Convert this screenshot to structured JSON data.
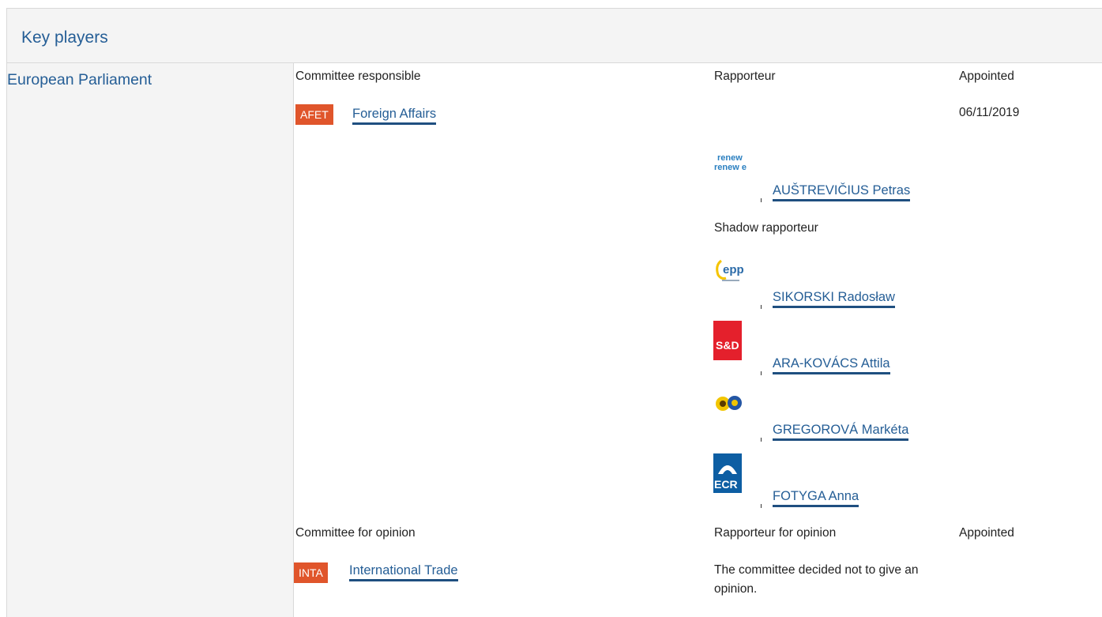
{
  "section": {
    "title": "Key players"
  },
  "institution": "European Parliament",
  "responsible": {
    "committee_header": "Committee responsible",
    "rapporteur_header": "Rapporteur",
    "appointed_header": "Appointed",
    "committee_code": "AFET",
    "committee_name": "Foreign Affairs",
    "appointed_date": "06/11/2019",
    "rapporteur": {
      "name": "AUŠTREVIČIUS Petras",
      "group_logo": "renew europe.",
      "group_icon": "renew-europe-logo-icon"
    },
    "shadow_header": "Shadow rapporteur",
    "shadows": [
      {
        "name": "SIKORSKI Radosław",
        "group_icon": "epp-logo-icon",
        "logo_text": "epp"
      },
      {
        "name": "ARA-KOVÁCS Attila",
        "group_icon": "s-and-d-logo-icon",
        "logo_text": "S&D"
      },
      {
        "name": "GREGOROVÁ Markéta",
        "group_icon": "greens-efa-logo-icon",
        "logo_text": ""
      },
      {
        "name": "FOTYGA Anna",
        "group_icon": "ecr-logo-icon",
        "logo_text": "ECR"
      }
    ]
  },
  "opinion": {
    "committee_header": "Committee for opinion",
    "rapporteur_header": "Rapporteur for opinion",
    "appointed_header": "Appointed",
    "committee_code": "INTA",
    "committee_name": "International Trade",
    "note": "The committee decided not to give an opinion."
  },
  "colors": {
    "link": "#255e96",
    "badge": "#e0552b",
    "header_bg": "#f4f4f4",
    "sd_red": "#e4202c",
    "ecr_blue": "#0d5ea3"
  }
}
